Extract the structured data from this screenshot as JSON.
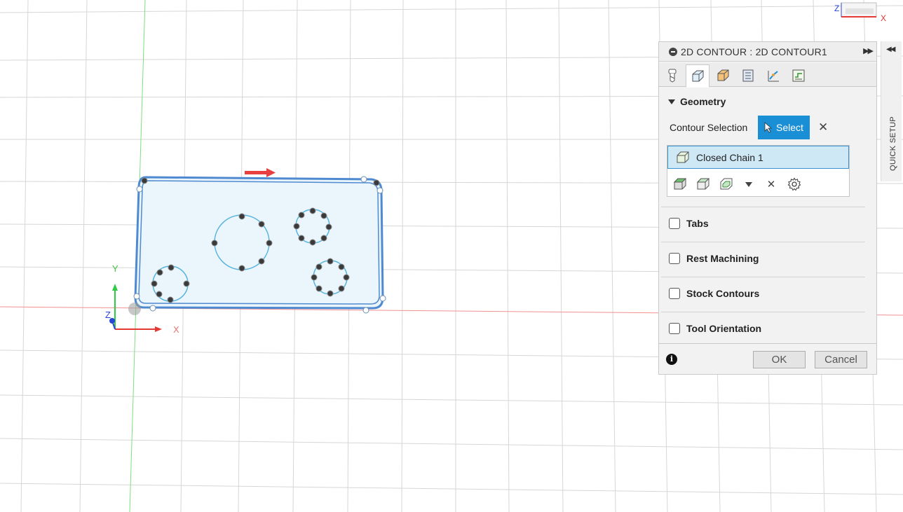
{
  "viewport": {
    "axes": {
      "x_label": "X",
      "y_label": "Y",
      "z_label": "Z"
    },
    "viewcube": {
      "z_label": "Z",
      "x_label": "X"
    },
    "colors": {
      "x_axis": "#e53935",
      "y_axis": "#2ecc40",
      "z_axis": "#2746d8",
      "part_outline": "#4f8ad1",
      "part_fill": "#e9f4fb",
      "hole": "#58b4de",
      "direction_arrow": "#e84040"
    }
  },
  "panel": {
    "title": "2D CONTOUR : 2D CONTOUR1",
    "tabs": [
      {
        "icon": "tool-icon",
        "active": false
      },
      {
        "icon": "geometry-icon",
        "active": true
      },
      {
        "icon": "heights-icon",
        "active": false
      },
      {
        "icon": "passes-icon",
        "active": false
      },
      {
        "icon": "linking-icon",
        "active": false
      },
      {
        "icon": "post-process-icon",
        "active": false
      }
    ],
    "geometry": {
      "title": "Geometry",
      "contour_selection_label": "Contour Selection",
      "select_button": "Select",
      "selection_item": "Closed Chain 1"
    },
    "options": [
      {
        "label": "Tabs",
        "checked": false
      },
      {
        "label": "Rest Machining",
        "checked": false
      },
      {
        "label": "Stock Contours",
        "checked": false
      },
      {
        "label": "Tool Orientation",
        "checked": false
      }
    ],
    "ok_label": "OK",
    "cancel_label": "Cancel"
  },
  "quick_setup": {
    "label": "QUICK SETUP"
  }
}
